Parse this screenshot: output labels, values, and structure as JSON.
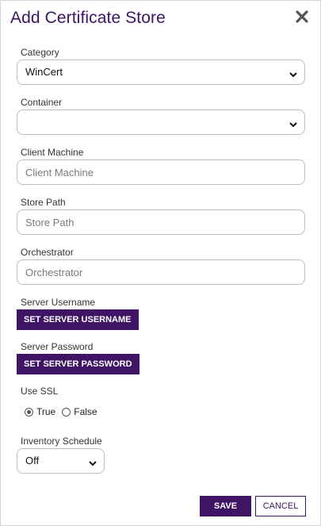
{
  "dialog": {
    "title": "Add Certificate Store",
    "close_icon": "close-icon"
  },
  "category": {
    "label": "Category",
    "value": "WinCert"
  },
  "container": {
    "label": "Container",
    "value": ""
  },
  "client_machine": {
    "label": "Client Machine",
    "value": "",
    "placeholder": "Client Machine"
  },
  "store_path": {
    "label": "Store Path",
    "value": "",
    "placeholder": "Store Path"
  },
  "orchestrator": {
    "label": "Orchestrator",
    "value": "",
    "placeholder": "Orchestrator"
  },
  "server_username": {
    "label": "Server Username",
    "button_label": "SET SERVER USERNAME"
  },
  "server_password": {
    "label": "Server Password",
    "button_label": "SET SERVER PASSWORD"
  },
  "use_ssl": {
    "label": "Use SSL",
    "options": [
      "True",
      "False"
    ],
    "selected": "True"
  },
  "inventory_schedule": {
    "label": "Inventory Schedule",
    "value": "Off"
  },
  "footer": {
    "save_label": "SAVE",
    "cancel_label": "CANCEL"
  },
  "colors": {
    "accent": "#3f1465",
    "border": "#bdbdbd"
  }
}
